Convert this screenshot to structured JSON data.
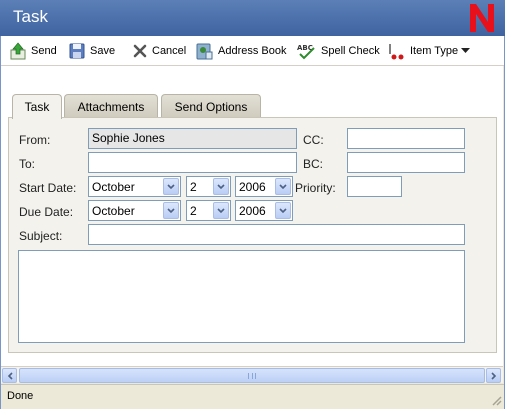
{
  "window": {
    "title": "Task"
  },
  "toolbar": {
    "send": "Send",
    "save": "Save",
    "cancel": "Cancel",
    "address_book": "Address Book",
    "spell_check": "Spell Check",
    "item_type": "Item Type"
  },
  "tabs": [
    {
      "label": "Task",
      "active": true
    },
    {
      "label": "Attachments",
      "active": false
    },
    {
      "label": "Send Options",
      "active": false
    }
  ],
  "form": {
    "from_label": "From:",
    "from_value": "Sophie Jones",
    "to_label": "To:",
    "to_value": "",
    "cc_label": "CC:",
    "cc_value": "",
    "bc_label": "BC:",
    "bc_value": "",
    "start_label": "Start Date:",
    "start_month": "October",
    "start_day": "2",
    "start_year": "2006",
    "priority_label": "Priority:",
    "priority_value": "",
    "due_label": "Due Date:",
    "due_month": "October",
    "due_day": "2",
    "due_year": "2006",
    "subject_label": "Subject:",
    "subject_value": "",
    "body_value": ""
  },
  "status": {
    "text": "Done"
  },
  "colors": {
    "title_bar": "#4a6fad",
    "logo_red": "#e8101a"
  }
}
